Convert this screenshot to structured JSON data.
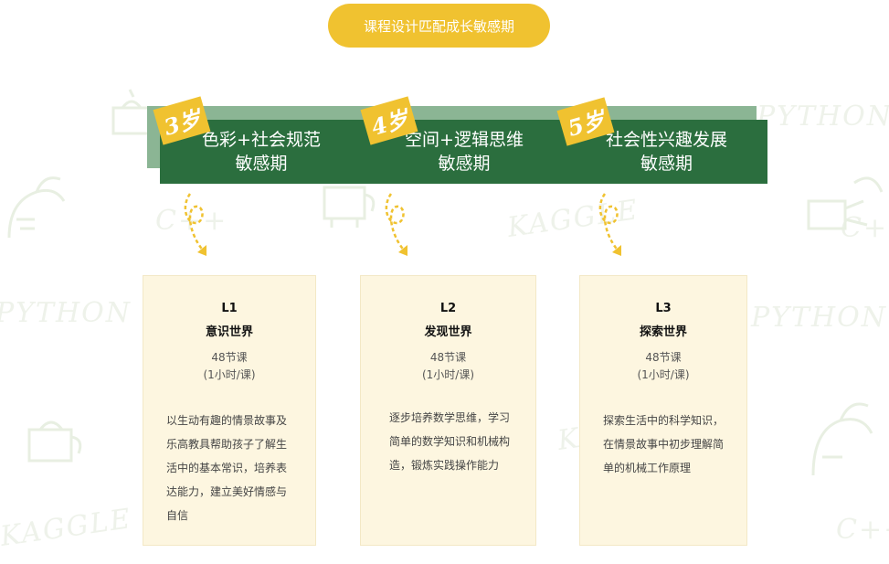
{
  "header": {
    "title": "课程设计匹配成长敏感期"
  },
  "background_words": [
    "PYTHON",
    "KAGGLE",
    "C++",
    "PYTHON",
    "KAGGLE",
    "C++",
    "PYTHON",
    "C++",
    "KAGGLE",
    "C++"
  ],
  "stages": [
    {
      "age": "3岁",
      "line1": "色彩+社会规范",
      "line2": "敏感期"
    },
    {
      "age": "4岁",
      "line1": "空间+逻辑思维",
      "line2": "敏感期"
    },
    {
      "age": "5岁",
      "line1": "社会性兴趣发展",
      "line2": "敏感期"
    }
  ],
  "cards": [
    {
      "level": "L1",
      "name": "意识世界",
      "lessons": "48节课",
      "duration": "(1小时/课)",
      "desc": [
        "以生动有趣的情景故事及",
        "乐高教具帮助孩子了解生",
        "活中的基本常识，培养表",
        "达能力，建立美好情感与",
        "自信"
      ]
    },
    {
      "level": "L2",
      "name": "发现世界",
      "lessons": "48节课",
      "duration": "(1小时/课)",
      "desc": [
        "逐步培养数学思维，学习",
        "简单的数学知识和机械构",
        "造，锻炼实践操作能力"
      ]
    },
    {
      "level": "L3",
      "name": "探索世界",
      "lessons": "48节课",
      "duration": "(1小时/课)",
      "desc": [
        "探索生活中的科学知识，",
        "在情景故事中初步理解简",
        "单的机械工作原理"
      ]
    }
  ],
  "colors": {
    "accent_yellow": "#f0c230",
    "band_green": "#2b6e3e",
    "band_shadow": "#8bb594",
    "card_bg": "#fdf6e0"
  },
  "icons": [
    "swirl-arrow-icon",
    "watermark-teapot-icon",
    "watermark-dino-icon"
  ]
}
